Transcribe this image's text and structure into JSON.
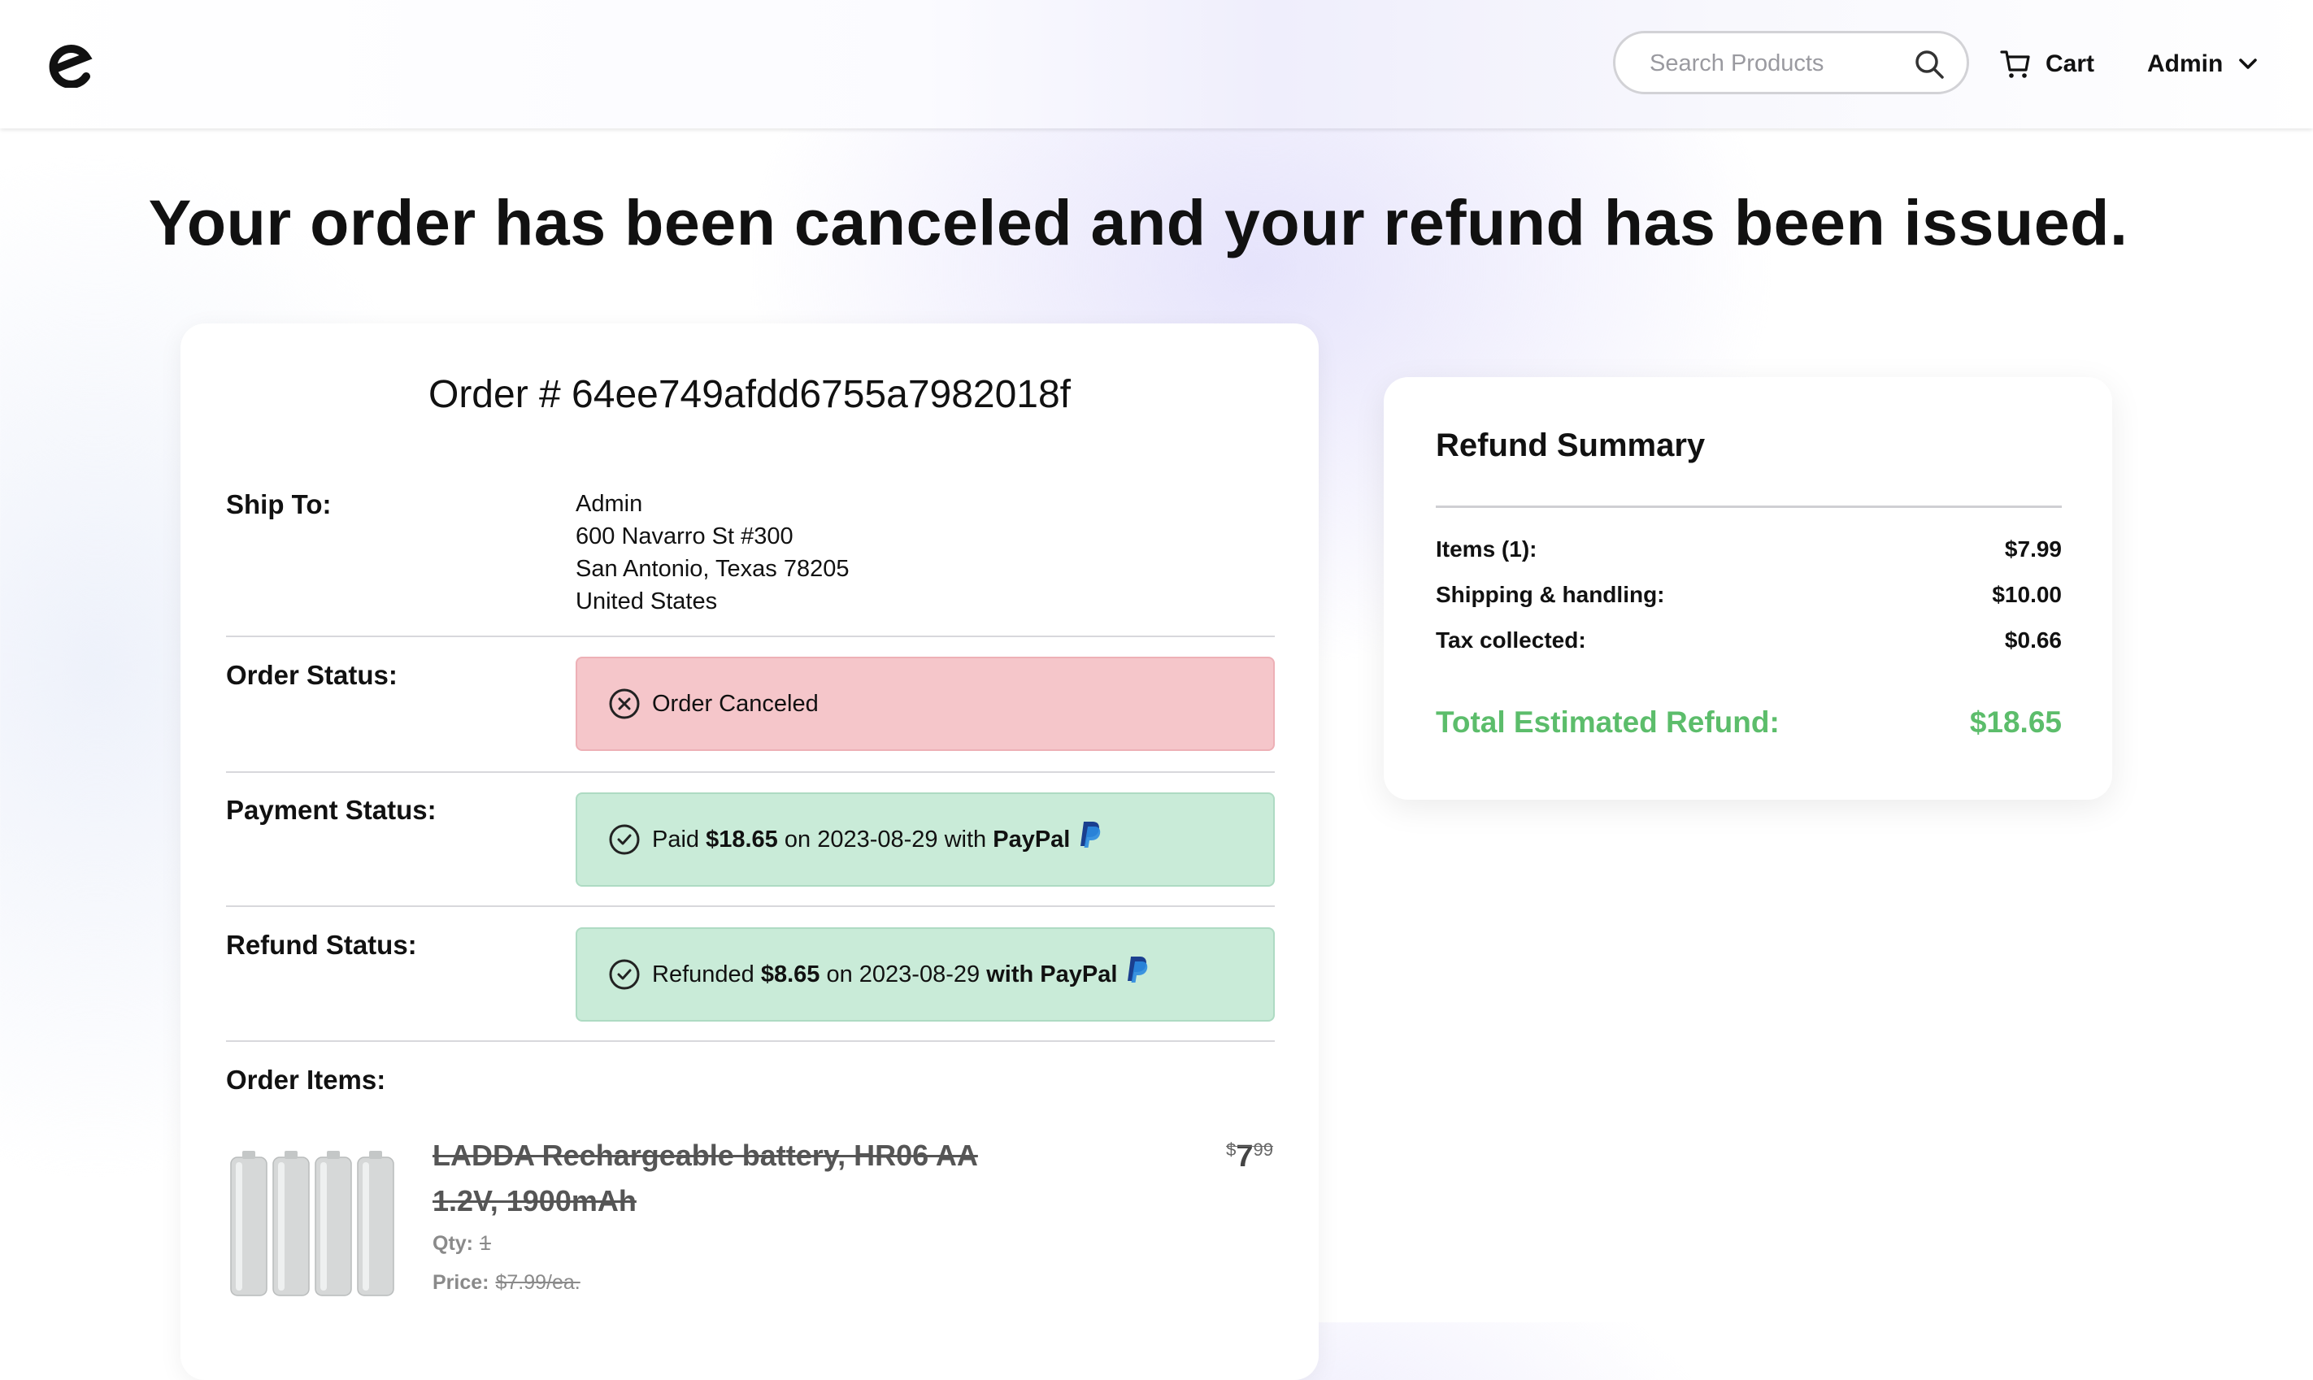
{
  "header": {
    "logo_letter": "e",
    "search": {
      "placeholder": "Search Products",
      "value": ""
    },
    "cart_label": "Cart",
    "user_label": "Admin"
  },
  "headline": "Your order has been canceled and your refund has been issued.",
  "order": {
    "title": "Order # 64ee749afdd6755a7982018f",
    "ship_to": {
      "label": "Ship To:",
      "lines": [
        "Admin",
        "600 Navarro St #300",
        "San Antonio, Texas 78205",
        "United States"
      ]
    },
    "order_status": {
      "label": "Order Status:",
      "text": "Order Canceled",
      "color": "#f5c6ca"
    },
    "payment_status": {
      "label": "Payment Status:",
      "prefix": "Paid",
      "amount": "$18.65",
      "middle": "on 2023-08-29 with",
      "method": "PayPal",
      "color": "#c9ebd8"
    },
    "refund_status": {
      "label": "Refund Status:",
      "prefix": "Refunded",
      "amount": "$8.65",
      "middle": "on 2023-08-29",
      "method": "with PayPal",
      "color": "#c9ebd8"
    },
    "items_label": "Order Items:",
    "items": [
      {
        "name": "LADDA Rechargeable battery, HR06 AA 1.2V, 1900mAh",
        "qty_label": "Qty:",
        "qty": "1",
        "price_label": "Price:",
        "unit_price": "$7.99/ea.",
        "price_symbol": "$",
        "price_dollars": "7",
        "price_cents": "99",
        "image": "battery-pack"
      }
    ]
  },
  "refund_summary": {
    "title": "Refund Summary",
    "lines": [
      {
        "label": "Items (1):",
        "value": "$7.99"
      },
      {
        "label": "Shipping & handling:",
        "value": "$10.00"
      },
      {
        "label": "Tax collected:",
        "value": "$0.66"
      }
    ],
    "total_label": "Total Estimated Refund:",
    "total_value": "$18.65",
    "total_color": "#5cbd6b"
  }
}
